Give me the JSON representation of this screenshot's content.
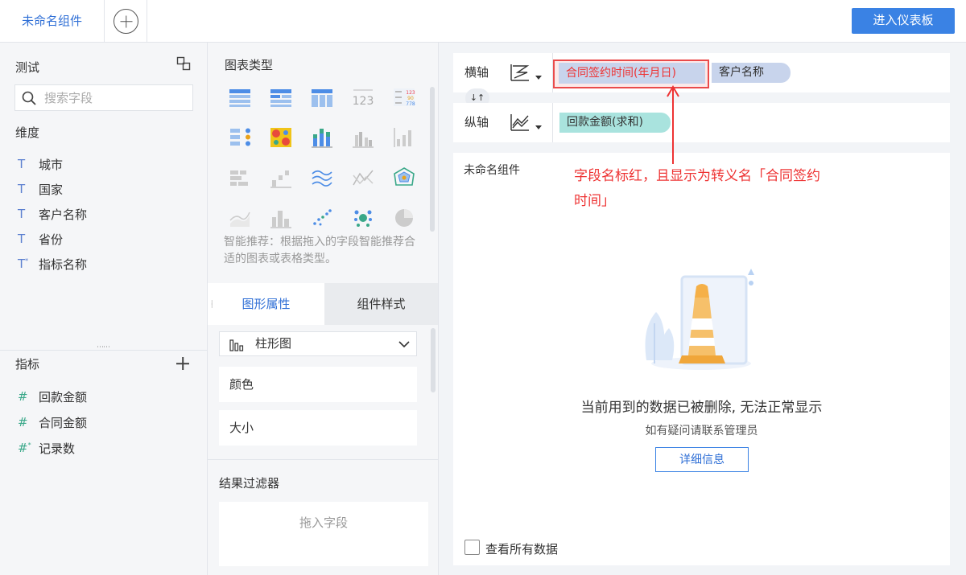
{
  "topbar": {
    "active_tab": "未命名组件",
    "enter_dashboard": "进入仪表板"
  },
  "field_panel": {
    "dataset_title": "测试",
    "search_placeholder": "搜索字段",
    "dimension_title": "维度",
    "dimensions": [
      {
        "icon": "T",
        "label": "城市"
      },
      {
        "icon": "T",
        "label": "国家"
      },
      {
        "icon": "T",
        "label": "客户名称"
      },
      {
        "icon": "T",
        "label": "省份"
      },
      {
        "icon": "T*",
        "label": "指标名称"
      }
    ],
    "metric_title": "指标",
    "metrics": [
      {
        "icon": "#",
        "label": "回款金额"
      },
      {
        "icon": "#",
        "label": "合同金额"
      },
      {
        "icon": "#*",
        "label": "记录数"
      }
    ]
  },
  "mid_panel": {
    "chart_type_title": "图表类型",
    "recommend_text": "智能推荐：根据拖入的字段智能推荐合适的图表或表格类型。",
    "tab_graph": "图形属性",
    "tab_style": "组件样式",
    "chart_select_value": "柱形图",
    "prop_color": "颜色",
    "prop_size": "大小",
    "filter_title": "结果过滤器",
    "drop_field": "拖入字段"
  },
  "axes": {
    "x_label": "横轴",
    "y_label": "纵轴",
    "x_fields": [
      "合同签约时间(年月日)",
      "客户名称"
    ],
    "y_fields": [
      "回款金额(求和)"
    ]
  },
  "canvas": {
    "widget_title": "未命名组件",
    "annotation": "字段名标红，且显示为转义名「合同签约时间」",
    "error_text": "当前用到的数据已被删除, 无法正常显示",
    "sub_text": "如有疑问请联系管理员",
    "detail_button": "详细信息",
    "check_all_label": "查看所有数据"
  },
  "colors": {
    "accent": "#3a82e4",
    "annotation_red": "#e33333",
    "dimension_pill": "#c8d4ec",
    "metric_pill": "#a9e3de"
  }
}
